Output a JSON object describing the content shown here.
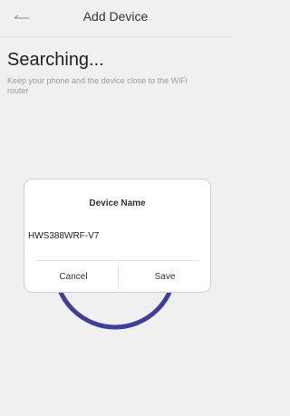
{
  "header": {
    "title": "Add Device",
    "back_icon": "arrow-left-icon"
  },
  "status": {
    "title": "Searching...",
    "subtitle": "Keep your phone and the device close to the WiFi router"
  },
  "progress": {
    "ring_color": "#3f3f9a"
  },
  "dialog": {
    "title": "Device Name",
    "device_name_value": "HWS388WRF-V7",
    "cancel_label": "Cancel",
    "save_label": "Save"
  },
  "colors": {
    "background": "#f0f0f0",
    "dialog_bg": "#ffffff",
    "accent": "#3f3f9a"
  }
}
